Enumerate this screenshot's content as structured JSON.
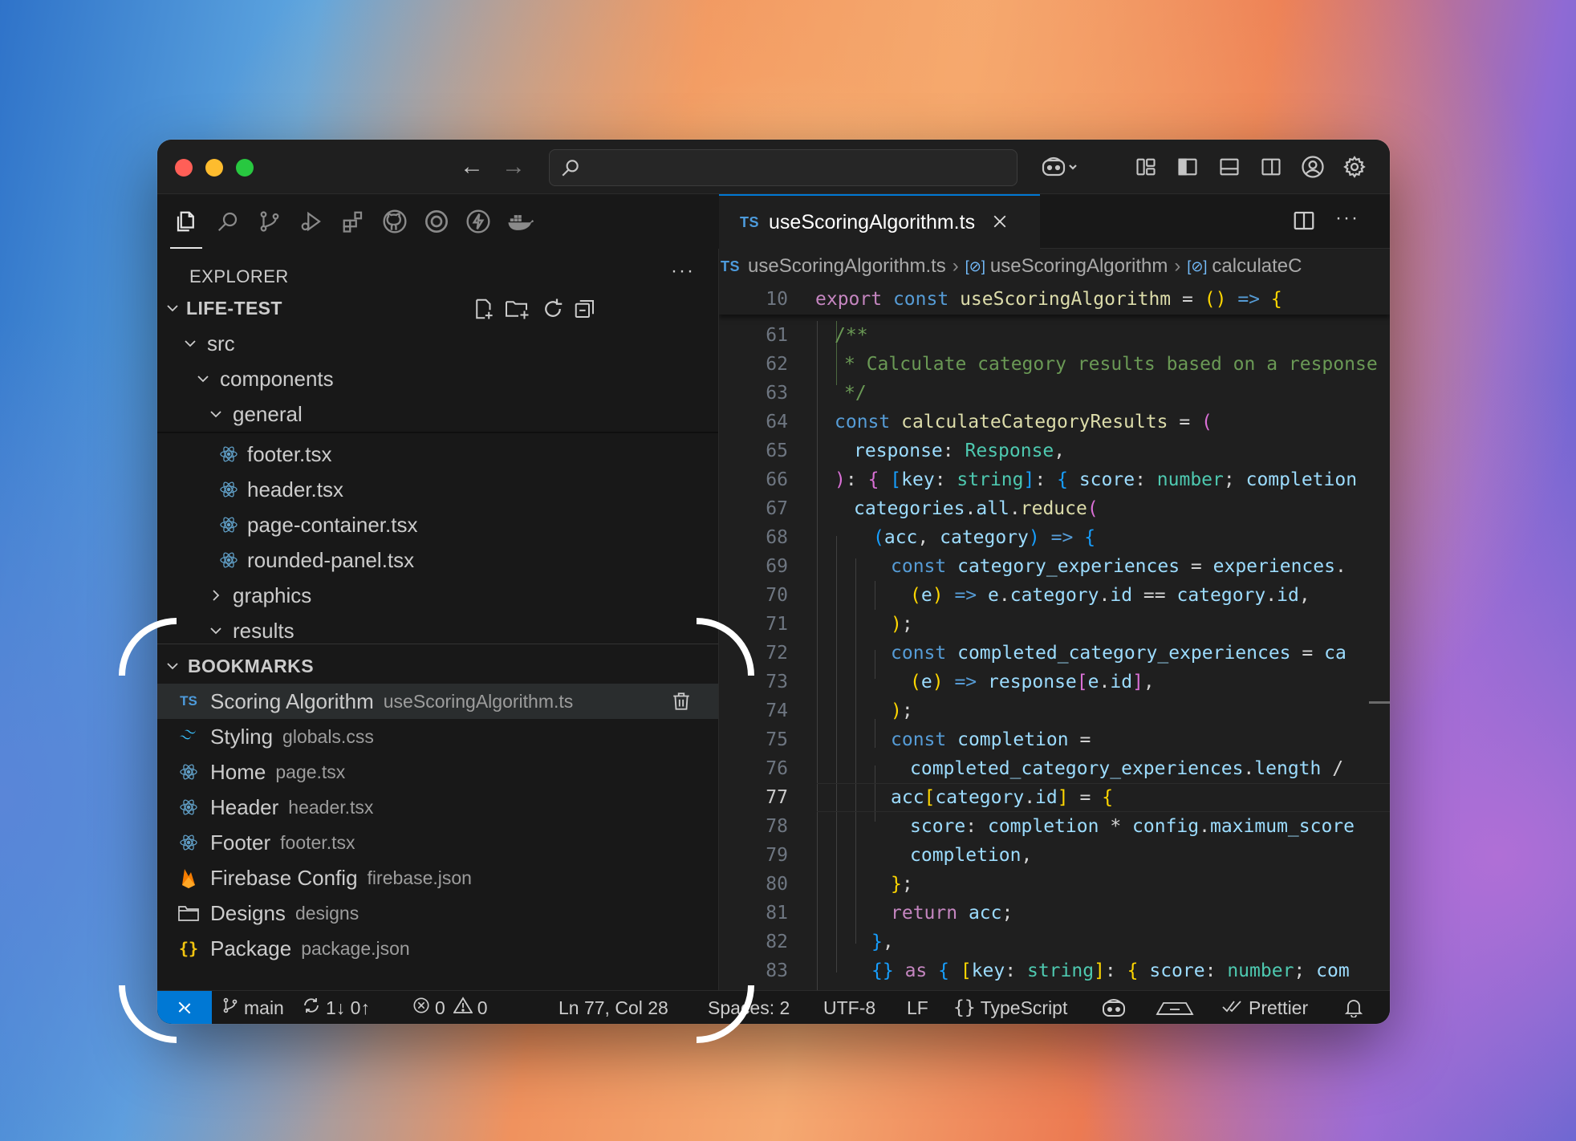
{
  "titlebar": {
    "nav_back": "←",
    "nav_forward": "→",
    "search_placeholder": ""
  },
  "sidebar": {
    "header": "EXPLORER",
    "folder": "LIFE-TEST",
    "tree": [
      {
        "label": "src"
      },
      {
        "label": "components"
      },
      {
        "label": "general"
      },
      {
        "label": "footer.tsx"
      },
      {
        "label": "header.tsx"
      },
      {
        "label": "page-container.tsx"
      },
      {
        "label": "rounded-panel.tsx"
      },
      {
        "label": "graphics"
      },
      {
        "label": "results"
      }
    ],
    "bookmarks_title": "BOOKMARKS",
    "bookmarks": [
      {
        "label": "Scoring Algorithm",
        "file": "useScoringAlgorithm.ts",
        "icon": "typescript-icon"
      },
      {
        "label": "Styling",
        "file": "globals.css",
        "icon": "tailwind-icon"
      },
      {
        "label": "Home",
        "file": "page.tsx",
        "icon": "react-icon"
      },
      {
        "label": "Header",
        "file": "header.tsx",
        "icon": "react-icon"
      },
      {
        "label": "Footer",
        "file": "footer.tsx",
        "icon": "react-icon"
      },
      {
        "label": "Firebase Config",
        "file": "firebase.json",
        "icon": "firebase-icon"
      },
      {
        "label": "Designs",
        "file": "designs",
        "icon": "folder-icon"
      },
      {
        "label": "Package",
        "file": "package.json",
        "icon": "json-icon"
      }
    ]
  },
  "editor": {
    "tab_badge": "TS",
    "tab_label": "useScoringAlgorithm.ts",
    "breadcrumb": {
      "badge": "TS",
      "file": "useScoringAlgorithm.ts",
      "symbol1": "useScoringAlgorithm",
      "symbol2": "calculateC"
    },
    "sticky_line_number": "10",
    "line_numbers": [
      "61",
      "62",
      "63",
      "64",
      "65",
      "66",
      "67",
      "68",
      "69",
      "70",
      "71",
      "72",
      "73",
      "74",
      "75",
      "76",
      "77",
      "78",
      "79",
      "80",
      "81",
      "82",
      "83"
    ],
    "current_line": "77"
  },
  "statusbar": {
    "branch": "main",
    "sync": "1↓ 0↑",
    "errors": "0",
    "warnings": "0",
    "cursor": "Ln 77, Col 28",
    "spaces": "Spaces: 2",
    "encoding": "UTF-8",
    "eol": "LF",
    "language_brackets": "{}",
    "language": "TypeScript",
    "prettier": "Prettier"
  },
  "colors": {
    "accent": "#0078d4",
    "window_bg": "#181818",
    "editor_bg": "#1f1f1f",
    "close": "#ff5f57",
    "minimize": "#febc2e",
    "maximize": "#28c840"
  }
}
